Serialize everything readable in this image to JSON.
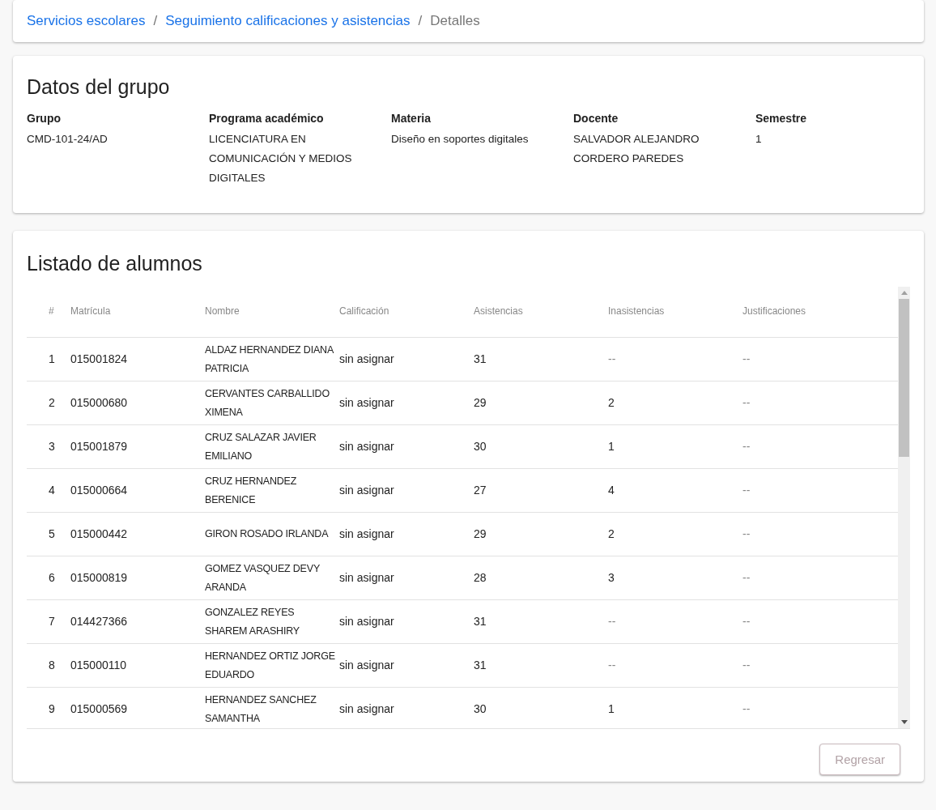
{
  "breadcrumb_separator": "/",
  "breadcrumb": [
    {
      "label": "Servicios escolares",
      "current": false
    },
    {
      "label": "Seguimiento calificaciones y asistencias",
      "current": false
    },
    {
      "label": "Detalles",
      "current": true
    }
  ],
  "group_card": {
    "title": "Datos del grupo",
    "fields": [
      {
        "label": "Grupo",
        "value": "CMD-101-24/AD"
      },
      {
        "label": "Programa académico",
        "value": "LICENCIATURA EN COMUNICACIÓN Y MEDIOS DIGITALES"
      },
      {
        "label": "Materia",
        "value": "Diseño en soportes digitales"
      },
      {
        "label": "Docente",
        "value": "SALVADOR ALEJANDRO CORDERO PAREDES"
      },
      {
        "label": "Semestre",
        "value": "1"
      }
    ]
  },
  "students_card": {
    "title": "Listado de alumnos",
    "table": {
      "columns": [
        "#",
        "Matrícula",
        "Nombre",
        "Calificación",
        "Asistencias",
        "Inasistencias",
        "Justificaciones"
      ],
      "rows": [
        [
          "1",
          "015001824",
          "ALDAZ HERNANDEZ DIANA PATRICIA",
          "sin asignar",
          "31",
          "--",
          "--"
        ],
        [
          "2",
          "015000680",
          "CERVANTES CARBALLIDO XIMENA",
          "sin asignar",
          "29",
          "2",
          "--"
        ],
        [
          "3",
          "015001879",
          "CRUZ SALAZAR JAVIER EMILIANO",
          "sin asignar",
          "30",
          "1",
          "--"
        ],
        [
          "4",
          "015000664",
          "CRUZ HERNANDEZ BERENICE",
          "sin asignar",
          "27",
          "4",
          "--"
        ],
        [
          "5",
          "015000442",
          "GIRON ROSADO IRLANDA",
          "sin asignar",
          "29",
          "2",
          "--"
        ],
        [
          "6",
          "015000819",
          "GOMEZ VASQUEZ DEVY ARANDA",
          "sin asignar",
          "28",
          "3",
          "--"
        ],
        [
          "7",
          "014427366",
          "GONZALEZ REYES SHAREM ARASHIRY",
          "sin asignar",
          "31",
          "--",
          "--"
        ],
        [
          "8",
          "015000110",
          "HERNANDEZ ORTIZ JORGE EDUARDO",
          "sin asignar",
          "31",
          "--",
          "--"
        ],
        [
          "9",
          "015000569",
          "HERNANDEZ SANCHEZ SAMANTHA",
          "sin asignar",
          "30",
          "1",
          "--"
        ]
      ]
    },
    "back_button": {
      "label": "Regresar",
      "disabled": true
    }
  }
}
